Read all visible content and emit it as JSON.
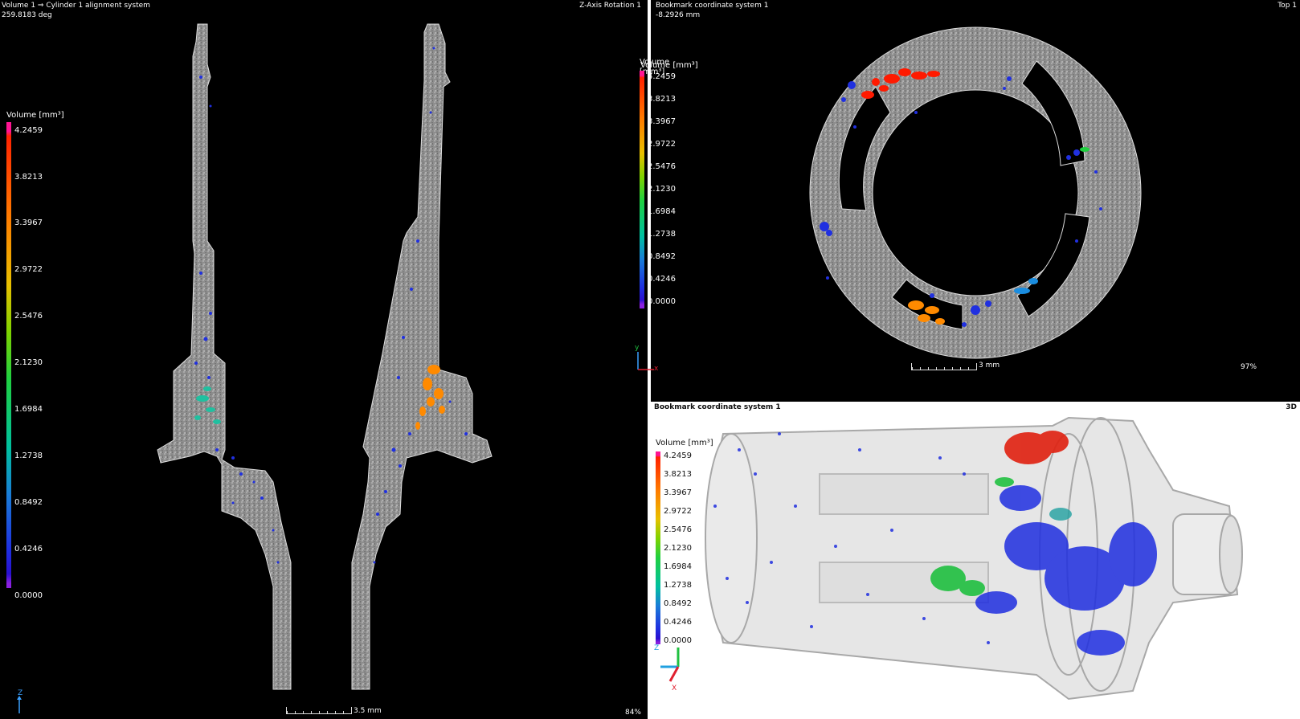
{
  "left_view": {
    "title": "Volume 1 ⇒ Cylinder 1 alignment system",
    "subtitle": "259.8183 deg",
    "view_name": "Z-Axis Rotation 1",
    "scale_label": "3.5 mm",
    "zoom": "84%",
    "axis_label": "Z",
    "colorbar": {
      "title": "Volume [mm³]",
      "ticks": [
        "4.2459",
        "3.8213",
        "3.3967",
        "2.9722",
        "2.5476",
        "2.1230",
        "1.6984",
        "1.2738",
        "0.8492",
        "0.4246",
        "0.0000"
      ]
    }
  },
  "top_right_view": {
    "title": "Bookmark coordinate system 1",
    "subtitle": "-8.2926 mm",
    "view_name": "Top 1",
    "scale_label": "3 mm",
    "zoom": "97%",
    "axis_y": "y",
    "axis_x": "x",
    "colorbar": {
      "title": "Volume [mm³]",
      "ticks": [
        "4.2459",
        "3.8213",
        "3.3967",
        "2.9722",
        "2.5476",
        "2.1230",
        "1.6984",
        "1.2738",
        "0.8492",
        "0.4246",
        "0.0000"
      ]
    }
  },
  "bottom_right_view": {
    "title": "Bookmark coordinate system 1",
    "view_name": "3D",
    "axis_z": "Z",
    "axis_x": "X",
    "colorbar": {
      "title": "Volume [mm³]",
      "ticks": [
        "4.2459",
        "3.8213",
        "3.3967",
        "2.9722",
        "2.5476",
        "2.1230",
        "1.6984",
        "1.2738",
        "0.8492",
        "0.4246",
        "0.0000"
      ]
    }
  },
  "colors": {
    "part_gray": "#9a9a9a",
    "pore_blue": "#1f2ee0",
    "pore_orange": "#ff8a00",
    "pore_red": "#ff1a00",
    "pore_teal": "#20c0a0",
    "pore_green": "#20d040"
  }
}
